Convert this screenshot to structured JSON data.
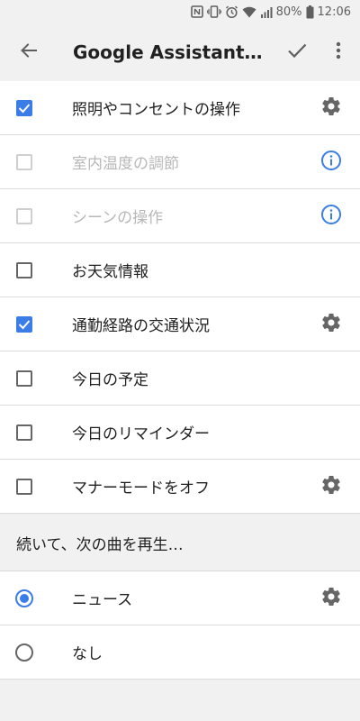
{
  "status_bar": {
    "battery_percent": "80%",
    "time": "12:06",
    "icons": [
      "nfc-icon",
      "vibrate-icon",
      "alarm-icon",
      "wifi-icon",
      "signal-icon",
      "battery-icon"
    ]
  },
  "app_bar": {
    "title": "Google Assistant…",
    "back_icon": "back-arrow-icon",
    "confirm_icon": "check-icon",
    "more_icon": "more-vert-icon"
  },
  "colors": {
    "accent": "#3b7de8",
    "background": "#f1f1f1",
    "divider": "#dadada",
    "disabled_text": "#b8b8b8",
    "icon_gray": "#666666"
  },
  "actions": [
    {
      "label": "照明やコンセントの操作",
      "checked": true,
      "enabled": true,
      "trailing": "gear-icon"
    },
    {
      "label": "室内温度の調節",
      "checked": false,
      "enabled": false,
      "trailing": "info-icon"
    },
    {
      "label": "シーンの操作",
      "checked": false,
      "enabled": false,
      "trailing": "info-icon"
    },
    {
      "label": "お天気情報",
      "checked": false,
      "enabled": true,
      "trailing": ""
    },
    {
      "label": "通勤経路の交通状況",
      "checked": true,
      "enabled": true,
      "trailing": "gear-icon"
    },
    {
      "label": "今日の予定",
      "checked": false,
      "enabled": true,
      "trailing": ""
    },
    {
      "label": "今日のリマインダー",
      "checked": false,
      "enabled": true,
      "trailing": ""
    },
    {
      "label": "マナーモードをオフ",
      "checked": false,
      "enabled": true,
      "trailing": "gear-icon"
    }
  ],
  "then_section": {
    "header": "続いて、次の曲を再生…",
    "options": [
      {
        "label": "ニュース",
        "selected": true,
        "trailing": "gear-icon"
      },
      {
        "label": "なし",
        "selected": false,
        "trailing": ""
      }
    ]
  }
}
